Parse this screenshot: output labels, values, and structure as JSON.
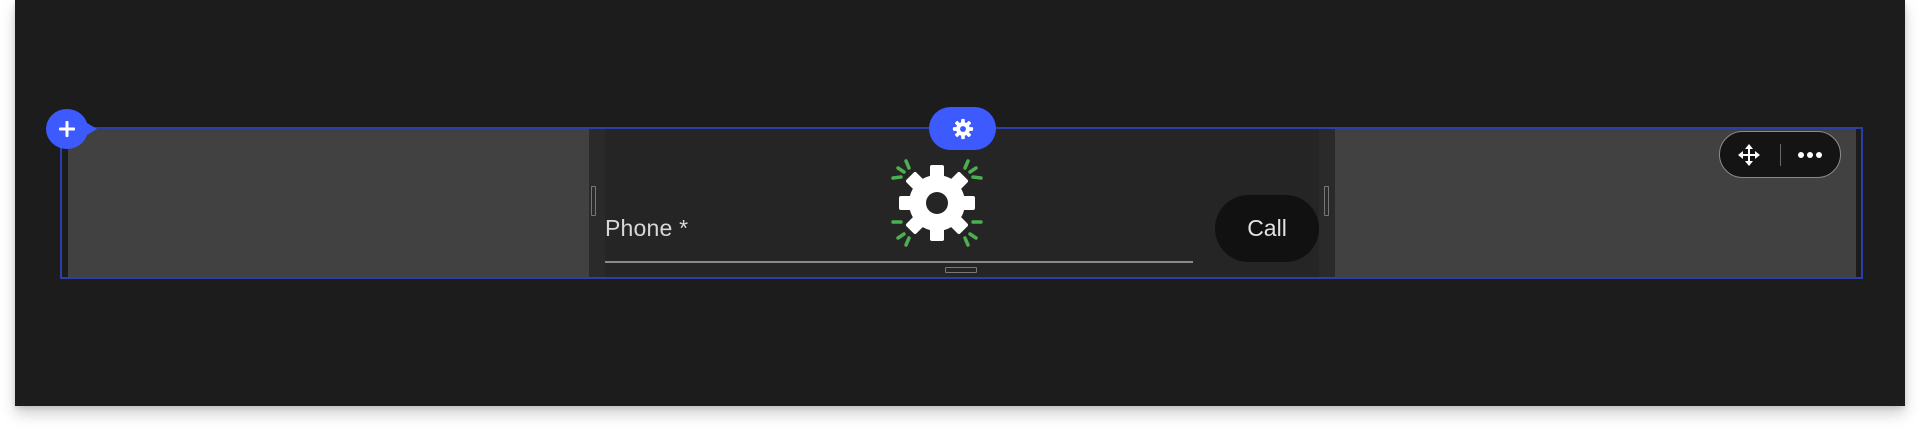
{
  "form": {
    "phone_label": "Phone *",
    "call_label": "Call"
  },
  "icons": {
    "add": "plus-icon",
    "settings": "gear-icon",
    "loading_gear": "gear-icon",
    "move": "move-arrows-icon",
    "more": "more-horizontal-icon"
  },
  "colors": {
    "accent": "#3d5afe",
    "selection_border": "#2b3faa",
    "spinner_green": "#4caf50",
    "canvas_bg": "#1c1c1c",
    "side_column_bg": "#414141",
    "call_button_bg": "#111111"
  }
}
